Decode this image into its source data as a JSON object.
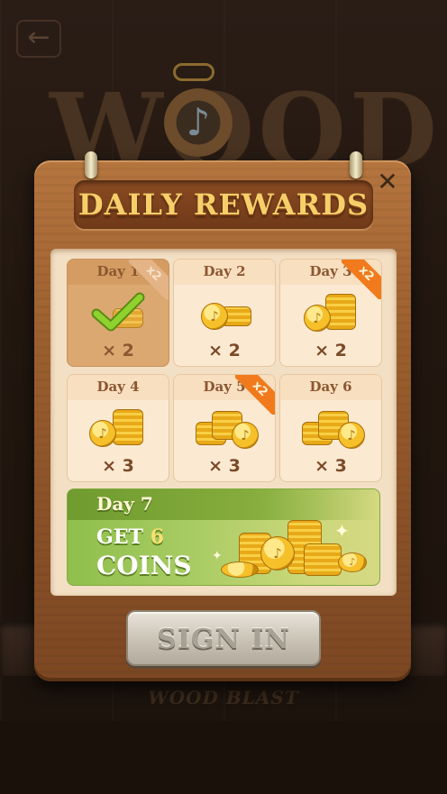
{
  "background": {
    "game_title": "WOOD",
    "footer_logo": "WOOD BLAST",
    "back_icon": "back-arrow-icon"
  },
  "popup": {
    "title": "DAILY REWARDS",
    "close_icon": "close-icon",
    "days": [
      {
        "label": "Day",
        "num": "1",
        "amount": "× 2",
        "bonus": "x2",
        "claimed": true
      },
      {
        "label": "Day",
        "num": "2",
        "amount": "× 2",
        "bonus": "",
        "claimed": false
      },
      {
        "label": "Day",
        "num": "3",
        "amount": "× 2",
        "bonus": "x2",
        "claimed": false
      },
      {
        "label": "Day",
        "num": "4",
        "amount": "× 3",
        "bonus": "",
        "claimed": false
      },
      {
        "label": "Day",
        "num": "5",
        "amount": "× 3",
        "bonus": "x2",
        "claimed": false
      },
      {
        "label": "Day",
        "num": "6",
        "amount": "× 3",
        "bonus": "",
        "claimed": false
      }
    ],
    "day7": {
      "label": "Day 7",
      "get": "GET",
      "count": "6",
      "coins": "COINS"
    },
    "sign_in": "SIGN IN"
  },
  "colors": {
    "accent": "#f07a1c",
    "title": "#f7cf6a",
    "day7_green": "#8fbf4c"
  }
}
